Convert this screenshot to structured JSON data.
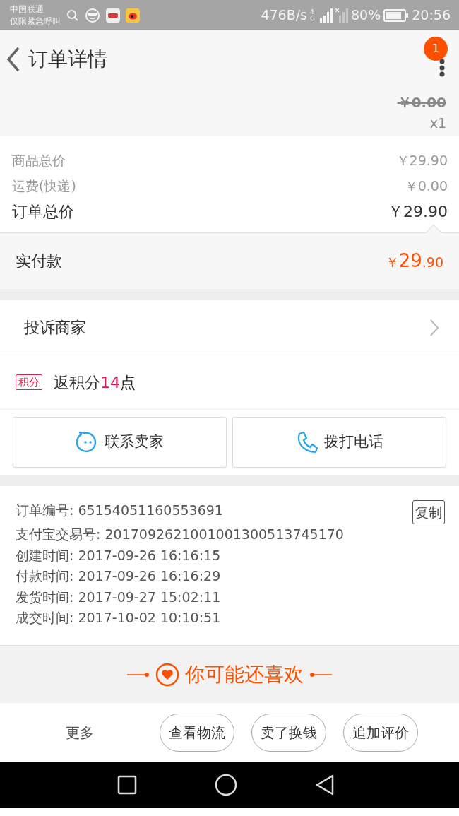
{
  "status_bar": {
    "carrier": "中国联通",
    "carrier_note": "仅限紧急呼叫",
    "speed": "476B/s",
    "network": "4G",
    "battery": "80%",
    "time": "20:56"
  },
  "header": {
    "title": "订单详情",
    "badge": "1"
  },
  "item": {
    "original_price": "￥0.00",
    "quantity": "x1"
  },
  "prices": [
    {
      "kind": "sub",
      "label": "商品总价",
      "value": "￥29.90"
    },
    {
      "kind": "sub",
      "label": "运费(快递)",
      "value": "￥0.00"
    },
    {
      "kind": "total",
      "label": "订单总价",
      "value": "￥29.90"
    }
  ],
  "paid": {
    "label": "实付款",
    "currency": "￥",
    "integer": "29",
    "decimal": ".90"
  },
  "complaint": {
    "label": "投诉商家"
  },
  "points": {
    "tag": "积分",
    "before": "返积分",
    "amount": "14",
    "after": "点"
  },
  "contact_buttons": [
    {
      "kind": "chat",
      "label": "联系卖家"
    },
    {
      "kind": "phone",
      "label": "拨打电话"
    }
  ],
  "order_info": [
    {
      "label": "订单编号:",
      "value": "65154051160553691",
      "copy": "复制"
    },
    {
      "label": "支付宝交易号:",
      "value": "2017092621001001300513745170"
    },
    {
      "label": "创建时间:",
      "value": "2017-09-26 16:16:15"
    },
    {
      "label": "付款时间:",
      "value": "2017-09-26 16:16:29"
    },
    {
      "label": "发货时间:",
      "value": "2017-09-27 15:02:11"
    },
    {
      "label": "成交时间:",
      "value": "2017-10-02 10:10:51"
    }
  ],
  "recommend": {
    "title": "你可能还喜欢"
  },
  "action_bar": {
    "more": "更多",
    "buttons": [
      "查看物流",
      "卖了换钱",
      "追加评价"
    ]
  }
}
